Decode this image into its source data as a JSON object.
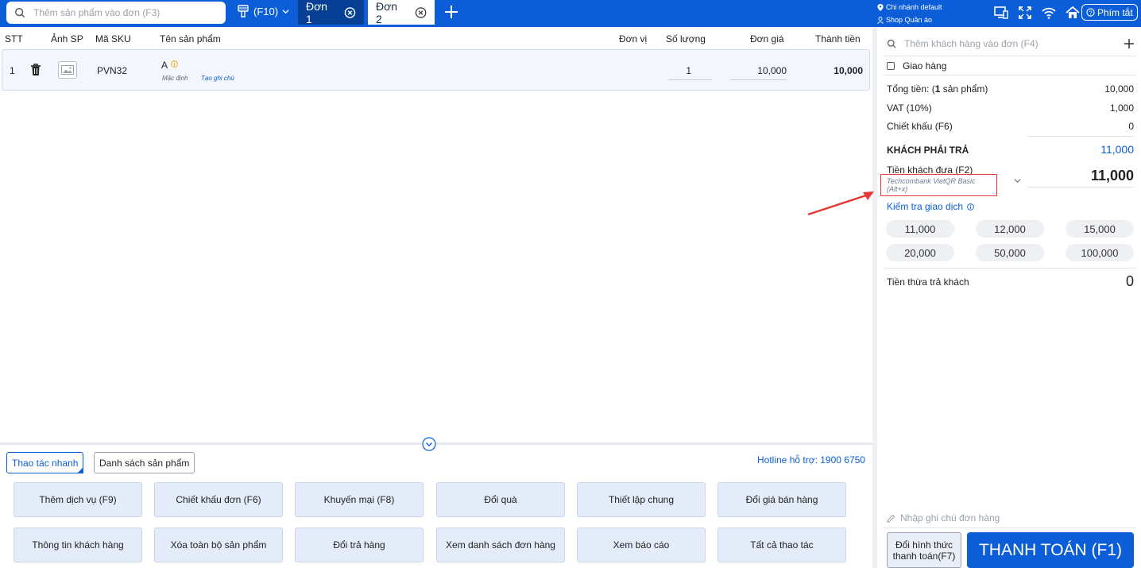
{
  "topbar": {
    "search_placeholder": "Thêm sản phẩm vào đơn (F3)",
    "f10_label": "(F10)",
    "tabs": [
      {
        "label": "Đơn 1",
        "active": true
      },
      {
        "label": "Đơn 2",
        "active": false
      }
    ],
    "branch": "Chi nhánh default",
    "shop": "Shop Quần áo",
    "shortcut_label": "Phím tắt",
    "icons": [
      "monitor-icon",
      "fullscreen-icon",
      "wifi-icon",
      "home-icon"
    ],
    "accent_color": "#0b5ed7"
  },
  "table": {
    "headers": {
      "stt": "STT",
      "image": "Ảnh SP",
      "sku": "Mã SKU",
      "name": "Tên sản phẩm",
      "unit": "Đơn vị",
      "qty": "Số lượng",
      "price": "Đơn giá",
      "total": "Thành tiền"
    },
    "rows": [
      {
        "stt": "1",
        "sku": "PVN32",
        "name": "A",
        "variant": "Mặc định",
        "note_link": "Tạo ghi chú",
        "unit": "",
        "qty": "1",
        "price": "10,000",
        "total": "10,000"
      }
    ]
  },
  "quick": {
    "tabs": [
      "Thao tác nhanh",
      "Danh sách sản phẩm"
    ],
    "hotline": "Hotline hỗ trợ: 1900 6750",
    "buttons": [
      "Thêm dịch vụ (F9)",
      "Chiết khấu đơn (F6)",
      "Khuyến mại (F8)",
      "Đổi quà",
      "Thiết lập chung",
      "Đổi giá bán hàng",
      "Thông tin khách hàng",
      "Xóa toàn bộ sản phẩm",
      "Đổi trả hàng",
      "Xem danh sách đơn hàng",
      "Xem báo cáo",
      "Tất cả thao tác"
    ]
  },
  "panel": {
    "customer_placeholder": "Thêm khách hàng vào đơn (F4)",
    "delivery_label": "Giao hàng",
    "total_label_prefix": "Tổng tiền: (",
    "total_count": "1",
    "total_label_suffix": " sản phẩm)",
    "total_value": "10,000",
    "vat_label": "VAT (10%)",
    "vat_value": "1,000",
    "discount_label": "Chiết khấu (F6)",
    "discount_value": "0",
    "payable_label": "KHÁCH PHẢI TRẢ",
    "payable_value": "11,000",
    "paid_label": "Tiền khách đưa (F2)",
    "payment_method": "Techcombank VietQR Basic (Alt+x)",
    "paid_value": "11,000",
    "check_label": "Kiểm tra giao dịch",
    "quick_amounts": [
      "11,000",
      "12,000",
      "15,000",
      "20,000",
      "50,000",
      "100,000"
    ],
    "change_label": "Tiền thừa trả khách",
    "change_value": "0",
    "note_placeholder": "Nhập ghi chú đơn hàng",
    "change_method_label": "Đổi hình thức thanh toán(F7)",
    "checkout_label": "THANH TOÁN (F1)"
  }
}
